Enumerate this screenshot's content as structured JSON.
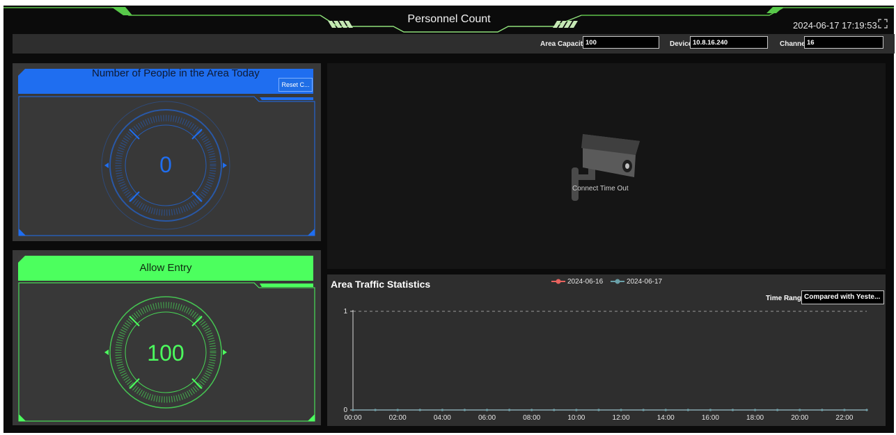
{
  "header": {
    "title": "Personnel Count",
    "datetime": "2024-06-17 17:19:53"
  },
  "settings": {
    "area_capacity_label": "Area Capacity",
    "area_capacity_value": "100",
    "device_label": "Device",
    "device_value": "10.8.16.240",
    "channel_label": "Channel",
    "channel_value": "16"
  },
  "people_panel": {
    "title": "Number of People in the Area Today",
    "reset_label": "Reset C...",
    "count": "0",
    "accent": "#1e6ef0"
  },
  "entry_panel": {
    "title": "Allow Entry",
    "count": "100",
    "accent": "#4cff5e"
  },
  "video": {
    "status": "Connect Time Out",
    "icon": "camera-icon"
  },
  "traffic": {
    "title": "Area Traffic Statistics",
    "time_range_label": "Time Range",
    "time_range_value": "Compared with Yeste..."
  },
  "chart_data": {
    "type": "line",
    "title": "Area Traffic Statistics",
    "x": [
      "00:00",
      "01:00",
      "02:00",
      "03:00",
      "04:00",
      "05:00",
      "06:00",
      "07:00",
      "08:00",
      "09:00",
      "10:00",
      "11:00",
      "12:00",
      "13:00",
      "14:00",
      "15:00",
      "16:00",
      "17:00",
      "18:00",
      "19:00",
      "20:00",
      "21:00",
      "22:00",
      "23:00"
    ],
    "x_tick_labels": [
      "00:00",
      "02:00",
      "04:00",
      "06:00",
      "08:00",
      "10:00",
      "12:00",
      "14:00",
      "16:00",
      "18:00",
      "20:00",
      "22:00"
    ],
    "ylim": [
      0,
      1
    ],
    "y_ticks": [
      "0",
      "1"
    ],
    "series": [
      {
        "name": "2024-06-16",
        "color": "#e8635e",
        "values": [
          0,
          0,
          0,
          0,
          0,
          0,
          0,
          0,
          0,
          0,
          0,
          0,
          0,
          0,
          0,
          0,
          0,
          0,
          0,
          0,
          0,
          0,
          0,
          0
        ]
      },
      {
        "name": "2024-06-17",
        "color": "#6aa0a8",
        "values": [
          0,
          0,
          0,
          0,
          0,
          0,
          0,
          0,
          0,
          0,
          0,
          0,
          0,
          0,
          0,
          0,
          0,
          0,
          0,
          0,
          0,
          0,
          0,
          0
        ]
      }
    ],
    "grid": "dashed line at max",
    "legend_position": "top-center"
  }
}
